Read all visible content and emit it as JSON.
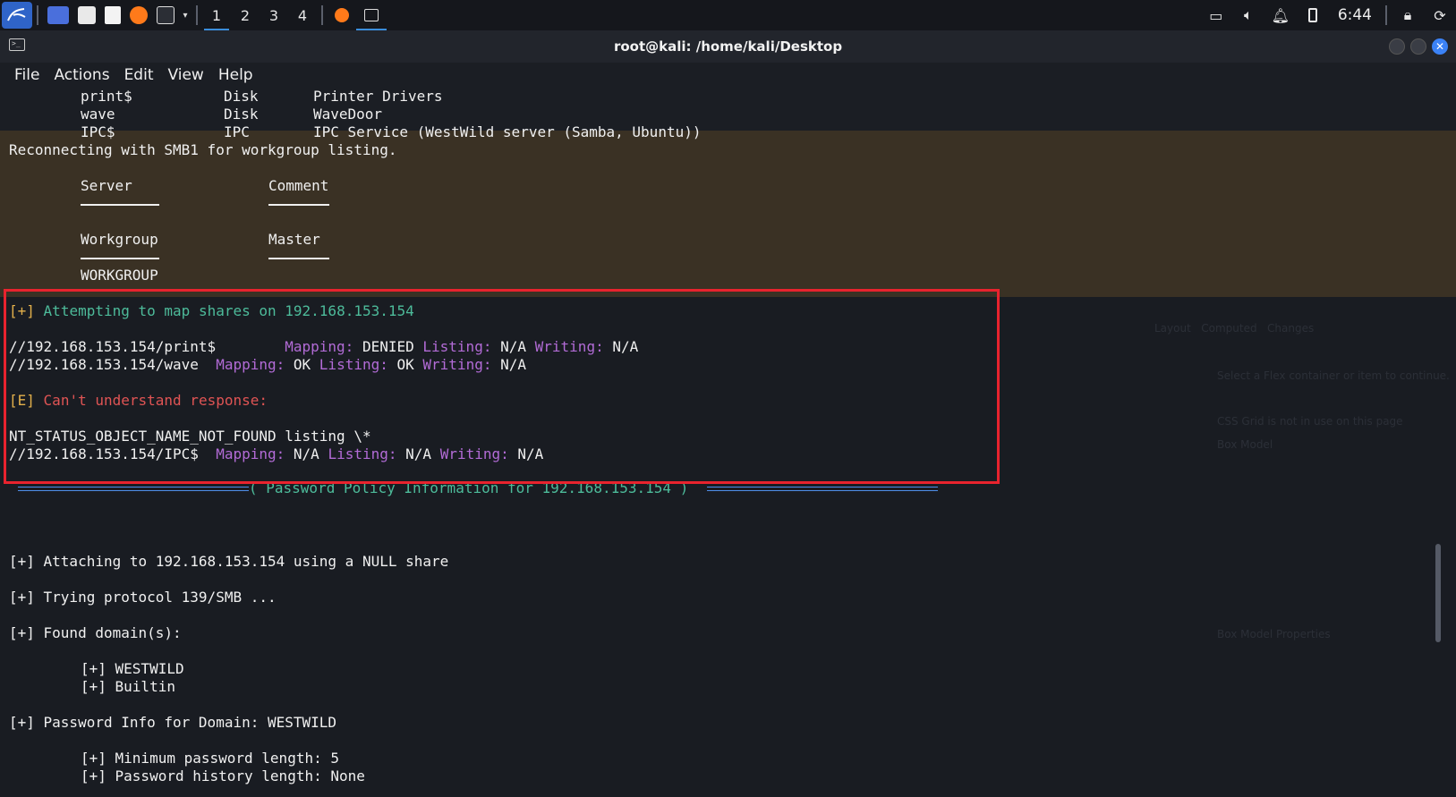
{
  "panel": {
    "workspaces": [
      "1",
      "2",
      "3",
      "4"
    ],
    "clock": "6:44"
  },
  "window": {
    "title": "root@kali: /home/kali/Desktop",
    "menu": [
      "File",
      "Actions",
      "Edit",
      "View",
      "Help"
    ]
  },
  "terminal": {
    "shares": [
      {
        "name": "print$",
        "type": "Disk",
        "comment": "Printer Drivers"
      },
      {
        "name": "wave",
        "type": "Disk",
        "comment": "WaveDoor"
      },
      {
        "name": "IPC$",
        "type": "IPC",
        "comment": "IPC Service (WestWild server (Samba, Ubuntu))"
      }
    ],
    "reconnect": "Reconnecting with SMB1 for workgroup listing.",
    "hdr_server": "Server",
    "hdr_comment": "Comment",
    "hdr_workgroup": "Workgroup",
    "hdr_master": "Master",
    "workgroup_val": "WORKGROUP",
    "map_tag": "[+]",
    "map_text": "Attempting to map shares on 192.168.153.154",
    "map_rows": [
      {
        "path": "//192.168.153.154/print$        ",
        "mapping": "DENIED",
        "listing": "N/A",
        "writing": "N/A"
      },
      {
        "path": "//192.168.153.154/wave  ",
        "mapping": "OK",
        "listing": "OK",
        "writing": "N/A"
      }
    ],
    "err_tag": "[E]",
    "err_text": "Can't understand response:",
    "nt_status": "NT_STATUS_OBJECT_NAME_NOT_FOUND listing \\*",
    "ipc_row": {
      "path": "//192.168.153.154/IPC$  ",
      "mapping": "N/A",
      "listing": "N/A",
      "writing": "N/A"
    },
    "lbl_mapping": "Mapping:",
    "lbl_listing": "Listing:",
    "lbl_writing": "Writing:",
    "policy_heading": "( Password Policy Information for 192.168.153.154 )",
    "attach": "[+] Attaching to 192.168.153.154 using a NULL share",
    "trying": "[+] Trying protocol 139/SMB ...",
    "found": "[+] Found domain(s):",
    "dom1": "[+] WESTWILD",
    "dom2": "[+] Builtin",
    "pwinfo": "[+] Password Info for Domain: WESTWILD",
    "minlen": "[+] Minimum password length: 5",
    "history": "[+] Password history length: None"
  },
  "colors": {
    "highlight_box": "#e8232e",
    "tag_yellow": "#e3b04b",
    "info_green": "#4dbb9a",
    "label_purple": "#b26bd6",
    "error_red": "#e05454",
    "heading_blue": "#4f8ee8"
  }
}
